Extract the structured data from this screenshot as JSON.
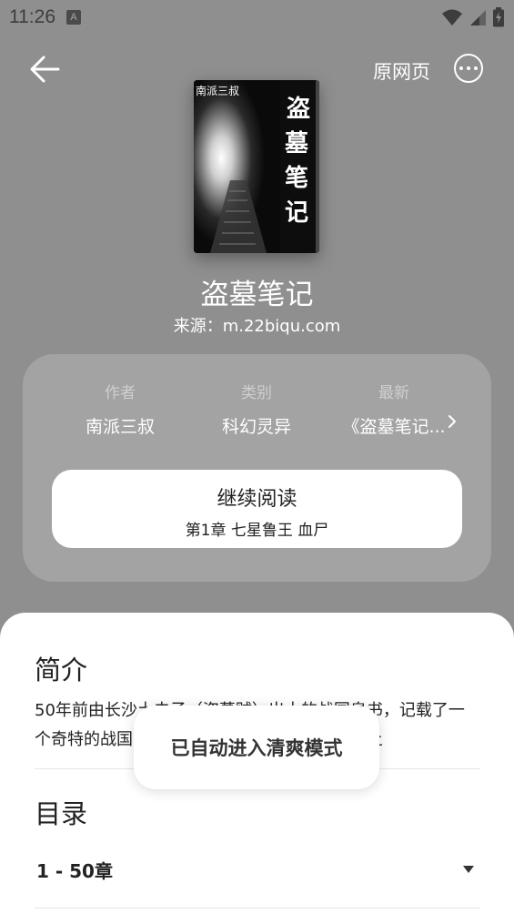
{
  "status_bar": {
    "time": "11:26",
    "notification_glyph": "A",
    "icons": [
      "wifi-icon",
      "signal-icon",
      "battery-charging-icon"
    ]
  },
  "nav": {
    "back_icon": "arrow-left-icon",
    "original_page_label": "原网页",
    "more_icon": "more-horizontal-icon"
  },
  "book": {
    "cover_author_text": "南派三叔",
    "cover_title_text": "盗墓笔记",
    "title": "盗墓笔记",
    "source": "来源：m.22biqu.com"
  },
  "info": {
    "author_label": "作者",
    "author_value": "南派三叔",
    "category_label": "类别",
    "category_value": "科幻灵异",
    "latest_label": "最新",
    "latest_value": "《盗墓笔记...",
    "continue_label": "继续阅读",
    "continue_chapter": "第1章 七星鲁王 血尸"
  },
  "sheet": {
    "intro_title": "简介",
    "intro_text": "50年前由长沙土夫子（盗墓贼）出土的战国帛书，记载了一个奇特的战国古墓的位置，50年后，其中一个土",
    "toc_title": "目录",
    "chapter_range": "1 - 50章"
  },
  "toast": {
    "message": "已自动进入清爽模式"
  },
  "colors": {
    "background": "#8f8f8f",
    "card": "#a3a3a3",
    "sheet": "#ffffff"
  }
}
